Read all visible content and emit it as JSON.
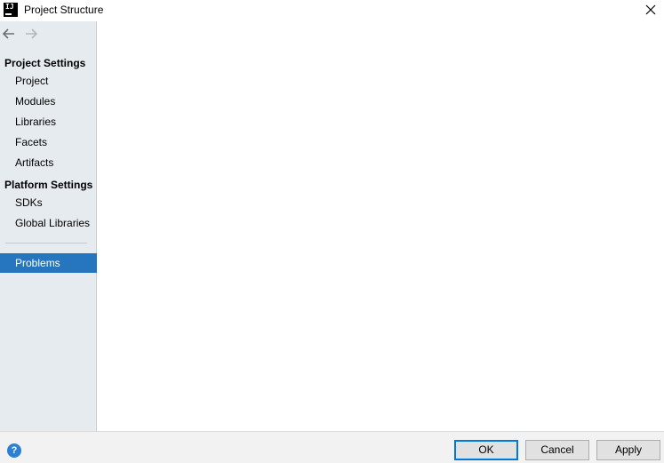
{
  "window": {
    "title": "Project Structure",
    "app_icon_text": "IJ",
    "app_icon": "intellij-icon",
    "close_icon": "close-icon"
  },
  "navigation": {
    "back_icon": "arrow-left-icon",
    "forward_icon": "arrow-right-icon"
  },
  "sidebar": {
    "project_settings_header": "Project Settings",
    "project_settings_items": [
      {
        "label": "Project"
      },
      {
        "label": "Modules"
      },
      {
        "label": "Libraries"
      },
      {
        "label": "Facets"
      },
      {
        "label": "Artifacts"
      }
    ],
    "platform_settings_header": "Platform Settings",
    "platform_settings_items": [
      {
        "label": "SDKs"
      },
      {
        "label": "Global Libraries"
      }
    ],
    "problems_label": "Problems",
    "selected_item": "Problems",
    "selection_color": "#2675bf"
  },
  "footer": {
    "help_icon": "help-icon",
    "help_glyph": "?",
    "ok_label": "OK",
    "cancel_label": "Cancel",
    "apply_label": "Apply"
  }
}
